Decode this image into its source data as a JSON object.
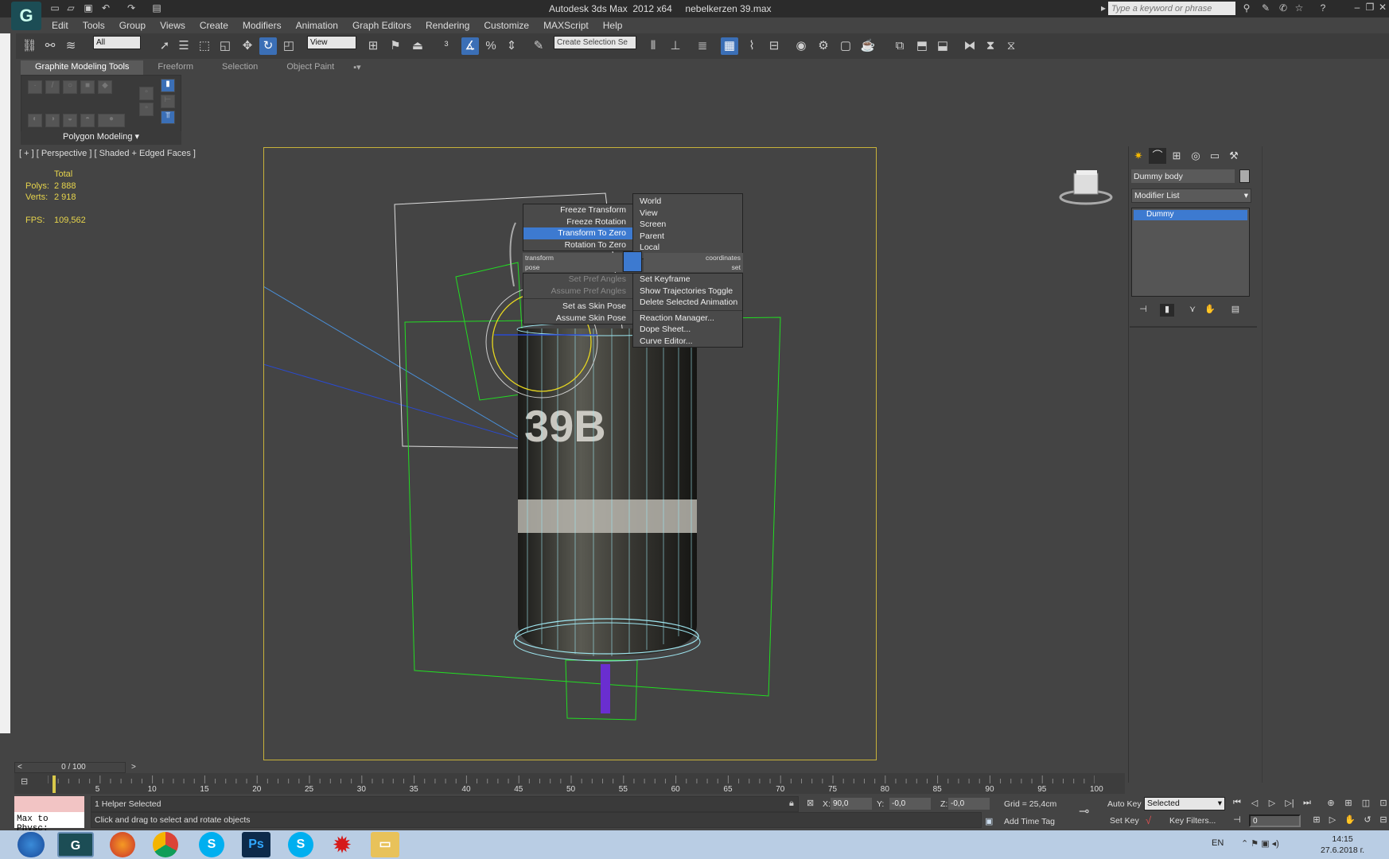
{
  "window": {
    "title": "Autodesk 3ds Max  2012 x64     nebelkerzen 39.max",
    "search_placeholder": "Type a keyword or phrase",
    "min_icon": "minimize-icon",
    "max_icon": "maximize-icon",
    "close_icon": "close-icon"
  },
  "menubar": [
    "Edit",
    "Tools",
    "Group",
    "Views",
    "Create",
    "Modifiers",
    "Animation",
    "Graph Editors",
    "Rendering",
    "Customize",
    "MAXScript",
    "Help"
  ],
  "toolbar": {
    "filter_select": "All",
    "coord_select": "View",
    "named_selection": "Create Selection Se"
  },
  "ribbon": {
    "tabs": [
      "Graphite Modeling Tools",
      "Freeform",
      "Selection",
      "Object Paint"
    ],
    "active_tab": "Graphite Modeling Tools",
    "panel_label": "Polygon Modeling"
  },
  "viewport": {
    "label": "[ + ] [ Perspective ] [ Shaded + Edged Faces ]",
    "stats_header": "Total",
    "polys_label": "Polys:",
    "polys_value": "2 888",
    "verts_label": "Verts:",
    "verts_value": "2 918",
    "fps_label": "FPS:",
    "fps_value": "109,562",
    "object_text": "39B"
  },
  "quad_menu": {
    "left_top": [
      "Freeze Transform",
      "Freeze Rotation",
      "Transform To Zero",
      "Rotation To Zero"
    ],
    "highlighted": "Transform To Zero",
    "right_top": [
      "World",
      "View",
      "Screen",
      "Parent",
      "Local"
    ],
    "label_transform": "transform",
    "label_coordinates": "coordinates",
    "label_pose": "pose",
    "label_set": "set",
    "left_bottom_disabled": [
      "Set Pref Angles",
      "Assume Pref Angles"
    ],
    "left_bottom": [
      "Set as Skin Pose",
      "Assume Skin Pose"
    ],
    "right_bottom_1": [
      "Set Keyframe",
      "Show Trajectories Toggle",
      "Delete Selected Animation"
    ],
    "right_bottom_2": [
      "Reaction Manager...",
      "Dope Sheet...",
      "Curve Editor..."
    ]
  },
  "command_panel": {
    "object_name": "Dummy body",
    "modifier_list": "Modifier List",
    "stack_item": "Dummy"
  },
  "timeline": {
    "slider": "0 / 100",
    "ticks": [
      "5",
      "10",
      "15",
      "20",
      "25",
      "30",
      "35",
      "40",
      "45",
      "50",
      "55",
      "60",
      "65",
      "70",
      "75",
      "80",
      "85",
      "90",
      "95",
      "100"
    ]
  },
  "status": {
    "maxscript": "Max to Physc:",
    "selection": "1 Helper Selected",
    "prompt": "Click and drag to select and rotate objects",
    "x_label": "X:",
    "x_value": "90,0",
    "y_label": "Y:",
    "y_value": "-0,0",
    "z_label": "Z:",
    "z_value": "-0,0",
    "grid": "Grid = 25,4cm",
    "add_time_tag": "Add Time Tag",
    "auto_key": "Auto Key",
    "key_mode": "Selected",
    "set_key": "Set Key",
    "key_filters": "Key Filters...",
    "frame": "0"
  },
  "taskbar": {
    "lang": "EN",
    "time": "14:15",
    "date": "27.6.2018 г."
  },
  "colors": {
    "highlight": "#3d7ad0",
    "stats": "#e6d44c",
    "safe_frame": "#c8b23a",
    "gizmo_green": "#22dd22"
  }
}
